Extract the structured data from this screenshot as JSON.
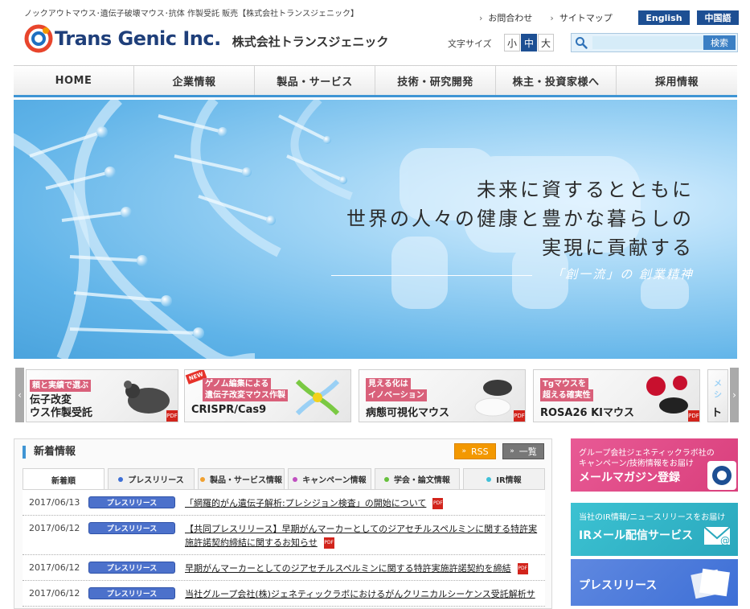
{
  "header": {
    "tagline": "ノックアウトマウス･遺伝子破壊マウス･抗体 作製受託 販売【株式会社トランスジェニック】",
    "logo_en": "Trans Genic Inc.",
    "logo_jp": "株式会社トランスジェニック",
    "links": [
      "お問合わせ",
      "サイトマップ"
    ],
    "lang": [
      "English",
      "中国語"
    ],
    "font_size_label": "文字サイズ",
    "font_sizes": [
      "小",
      "中",
      "大"
    ],
    "search_placeholder": "",
    "search_button": "検索"
  },
  "nav": [
    "HOME",
    "企業情報",
    "製品・サービス",
    "技術・研究開発",
    "株主・投資家様へ",
    "採用情報"
  ],
  "hero": {
    "lines": [
      "未来に資するとともに",
      "世界の人々の健康と豊かな暮らしの",
      "実現に貢献する"
    ],
    "motto": "「創一流」の 創業精神"
  },
  "banners": [
    {
      "sub": "頼と実績で選ぶ",
      "main": "伝子改変\nウス作製受託",
      "main1": "伝子改変",
      "main2": "ウス作製受託"
    },
    {
      "badge": "NEW",
      "sub1": "ゲノム編集による",
      "sub2": "遺伝子改変マウス作製",
      "main": "CRISPR/Cas9"
    },
    {
      "sub1": "見える化は",
      "sub2": "イノベーション",
      "main": "病態可視化マウス"
    },
    {
      "sub1": "Tgマウスを",
      "sub2": "超える確実性",
      "main": "ROSA26 KIマウス"
    },
    {
      "sub1": "メ",
      "sub2": "シ",
      "main": "ト"
    }
  ],
  "news": {
    "title": "新着情報",
    "rss": "RSS",
    "list_all": "一覧",
    "tabs": [
      {
        "label": "新着順",
        "dot": ""
      },
      {
        "label": "プレスリリース",
        "dot": "#3d6fd6"
      },
      {
        "label": "製品・サービス情報",
        "dot": "#f0a030"
      },
      {
        "label": "キャンペーン情報",
        "dot": "#c04fc0"
      },
      {
        "label": "学会・論文情報",
        "dot": "#66c03c"
      },
      {
        "label": "IR情報",
        "dot": "#3fc0d8"
      }
    ],
    "items": [
      {
        "date": "2017/06/13",
        "category": "プレスリリース",
        "text": "「網羅的がん遺伝子解析:プレシジョン検査」の開始について"
      },
      {
        "date": "2017/06/12",
        "category": "プレスリリース",
        "text": "【共同プレスリリース】早期がんマーカーとしてのジアセチルスペルミンに関する特許実施許諾契約締結に関するお知らせ"
      },
      {
        "date": "2017/06/12",
        "category": "プレスリリース",
        "text": "早期がんマーカーとしてのジアセチルスペルミンに関する特許実施許諾契約を締結"
      },
      {
        "date": "2017/06/12",
        "category": "プレスリリース",
        "text": "当社グループ会社(株)ジェネティックラボにおけるがんクリニカルシーケンス受託解析サ"
      }
    ],
    "pdf_label": "PDF"
  },
  "side": [
    {
      "sub1": "グループ会社ジェネティックラボ社の",
      "sub2": "キャンペーン/技術情報をお届け",
      "main": "メールマガジン登録",
      "color": "#e0508a"
    },
    {
      "sub1": "当社のIR情報/ニュースリリースをお届け",
      "sub2": "",
      "main": "IRメール配信サービス",
      "color": "#2fb6c8"
    },
    {
      "sub1": "",
      "sub2": "",
      "main": "プレスリリース",
      "color": "#3d6fd6"
    }
  ]
}
